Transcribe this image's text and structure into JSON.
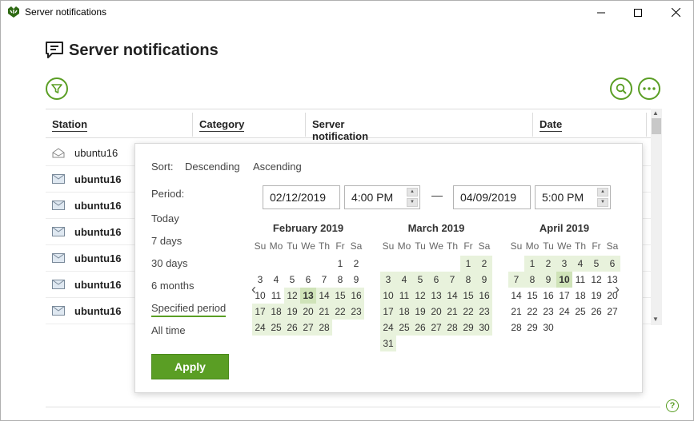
{
  "window": {
    "title": "Server notifications"
  },
  "page": {
    "title": "Server notifications"
  },
  "table": {
    "columns": [
      "Station",
      "Category",
      "Server notification",
      "Date"
    ],
    "rows": [
      {
        "station": "ubuntu16",
        "read": true
      },
      {
        "station": "ubuntu16",
        "read": false
      },
      {
        "station": "ubuntu16",
        "read": false
      },
      {
        "station": "ubuntu16",
        "read": false
      },
      {
        "station": "ubuntu16",
        "read": false
      },
      {
        "station": "ubuntu16",
        "read": false
      },
      {
        "station": "ubuntu16",
        "read": false
      }
    ]
  },
  "popup": {
    "sort_label": "Sort:",
    "sort_desc": "Descending",
    "sort_asc": "Ascending",
    "period_label": "Period:",
    "period_options": [
      "Today",
      "7 days",
      "30 days",
      "6 months",
      "Specified period",
      "All time"
    ],
    "active_period": "Specified period",
    "from_date": "02/12/2019",
    "from_time": "4:00 PM",
    "dash": "—",
    "to_date": "04/09/2019",
    "to_time": "5:00 PM",
    "apply_label": "Apply",
    "weekdays": [
      "Su",
      "Mo",
      "Tu",
      "We",
      "Th",
      "Fr",
      "Sa"
    ],
    "months": [
      {
        "title": "February 2019",
        "first_weekday": 5,
        "days": 28
      },
      {
        "title": "March 2019",
        "first_weekday": 5,
        "days": 31
      },
      {
        "title": "April 2019",
        "first_weekday": 1,
        "days": 30
      }
    ]
  },
  "colors": {
    "accent": "#5a9e24",
    "range": "#e8f2dc",
    "selected": "#cfe3b8"
  }
}
